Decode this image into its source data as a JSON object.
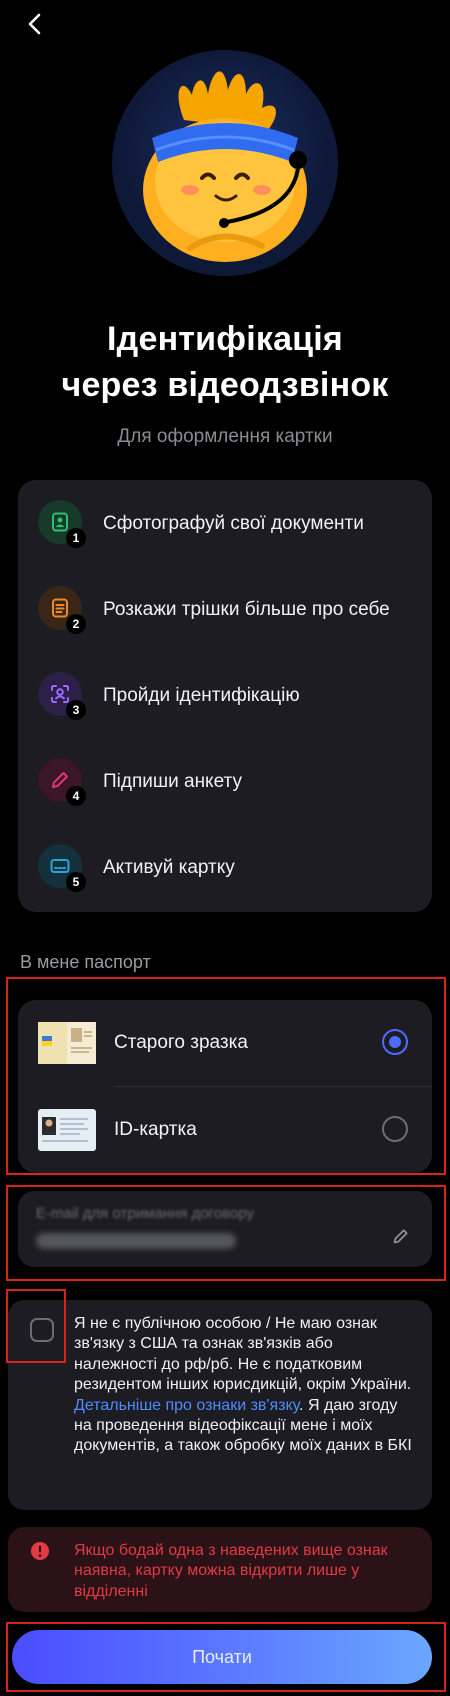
{
  "header": {
    "back_icon": "chevron-left-icon"
  },
  "hero": {
    "title_line1": "Ідентифікація",
    "title_line2": "через відеодзвінок",
    "subtitle": "Для оформлення картки"
  },
  "steps": [
    {
      "number": "1",
      "label": "Сфотографуй свої документи",
      "icon": "document-photo-icon",
      "color": "#2fbf71"
    },
    {
      "number": "2",
      "label": "Розкажи трішки більше про себе",
      "icon": "form-list-icon",
      "color": "#f08a24"
    },
    {
      "number": "3",
      "label": "Пройди ідентифікацію",
      "icon": "face-scan-icon",
      "color": "#9b6bff"
    },
    {
      "number": "4",
      "label": "Підпиши анкету",
      "icon": "pen-icon",
      "color": "#e0337a"
    },
    {
      "number": "5",
      "label": "Активуй картку",
      "icon": "card-icon",
      "color": "#28a6d8"
    }
  ],
  "passport": {
    "section_label": "В мене паспорт",
    "options": [
      {
        "label": "Старого зразка",
        "selected": true
      },
      {
        "label": "ID-картка",
        "selected": false
      }
    ]
  },
  "email": {
    "placeholder": "E-mail для отримання договору",
    "icon": "pencil-icon"
  },
  "consent": {
    "text_before": "Я не є публічною особою / Не маю ознак зв'язку з США та ознак зв'язків або належності до рф/рб. Не є податковим резидентом інших юрисдикцій, окрім України. ",
    "link_text": "Детальніше про ознаки зв'язку",
    "text_after": ". Я даю згоду на проведення відеофіксації мене і моїх документів, а також обробку моїх даних в БКІ",
    "checked": false
  },
  "warning": {
    "text": "Якщо бодай одна з наведених вище ознак наявна, картку можна відкрити лише у відділенні",
    "icon": "alert-icon",
    "color": "#e23a44"
  },
  "actions": {
    "start_label": "Почати"
  },
  "colors": {
    "accent": "#4d6cff",
    "background": "#000000",
    "card": "#1c1c22"
  }
}
